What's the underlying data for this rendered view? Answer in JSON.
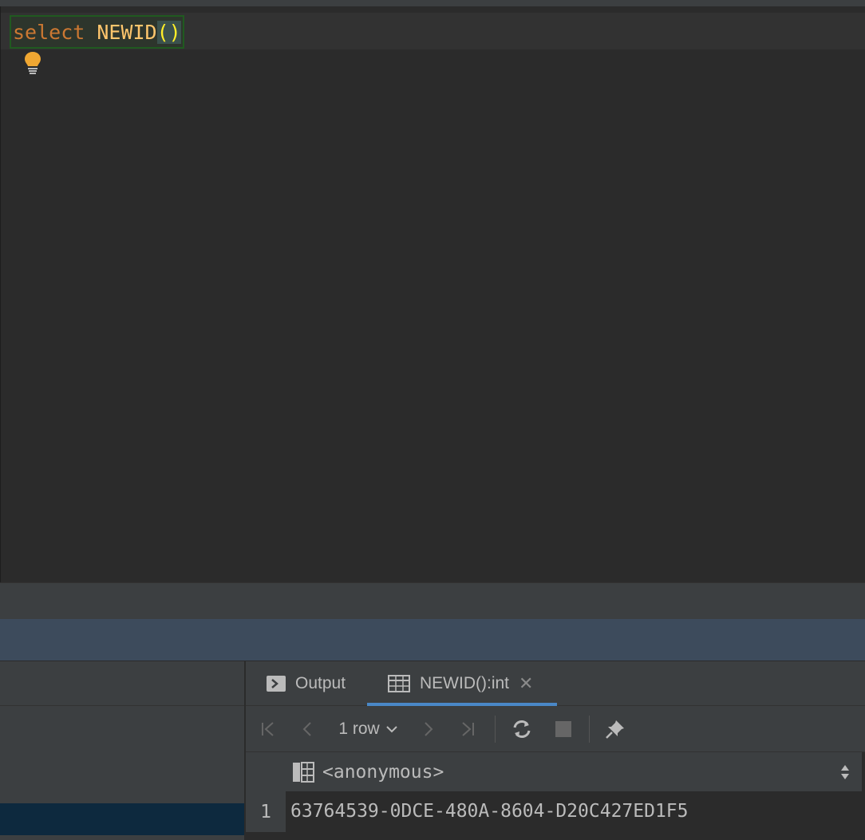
{
  "editor": {
    "keyword": "select",
    "function": "NEWID",
    "parens": "()"
  },
  "results": {
    "tabs": [
      {
        "label": "Output"
      },
      {
        "label": "NEWID():int",
        "close": "✕"
      }
    ],
    "toolbar": {
      "row_count": "1 row"
    },
    "columns": [
      "<anonymous>"
    ],
    "rows": [
      {
        "num": "1",
        "values": [
          "63764539-0DCE-480A-8604-D20C427ED1F5"
        ]
      }
    ]
  },
  "colors": {
    "keyword": "#cc7832",
    "function": "#ffc66d",
    "paren": "#ffef28",
    "tab_underline": "#4a88c7",
    "bulb": "#f0a732"
  }
}
